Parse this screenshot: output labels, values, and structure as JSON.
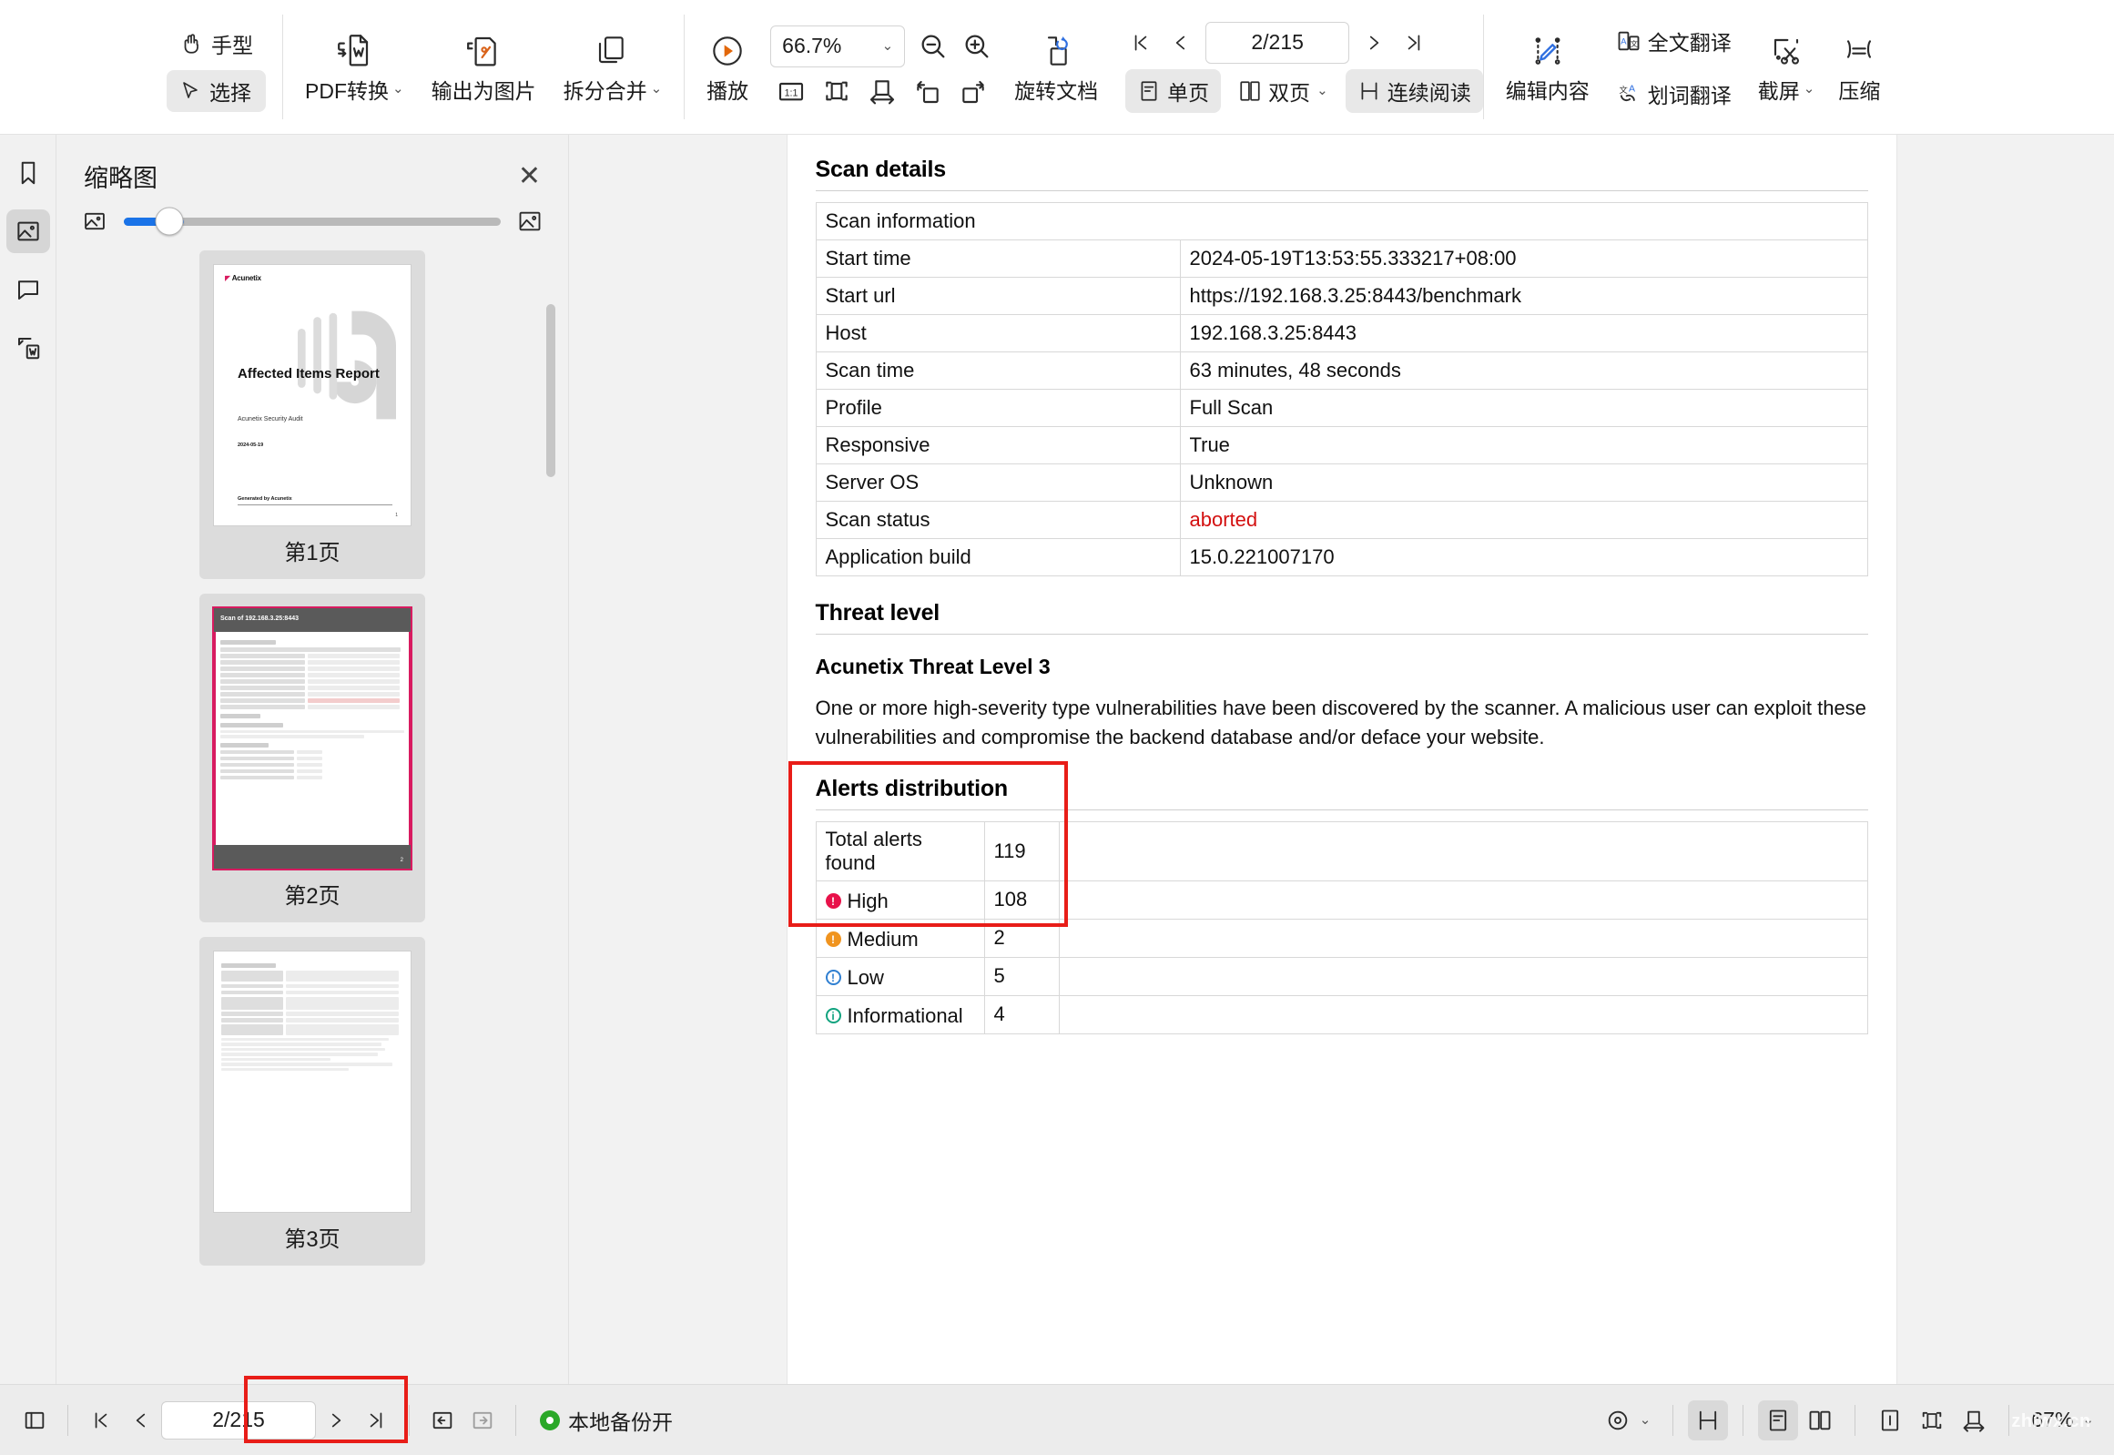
{
  "toolbar": {
    "hand_label": "手型",
    "select_label": "选择",
    "pdf_convert_label": "PDF转换",
    "export_image_label": "输出为图片",
    "split_merge_label": "拆分合并",
    "play_label": "播放",
    "zoom_value": "66.7%",
    "page_indicator": "2/215",
    "rotate_doc_label": "旋转文档",
    "single_page_label": "单页",
    "double_page_label": "双页",
    "continuous_read_label": "连续阅读",
    "edit_content_label": "编辑内容",
    "full_translate_label": "全文翻译",
    "word_translate_label": "划词翻译",
    "screenshot_label": "截屏",
    "compress_label": "压缩",
    "caret": "⌄"
  },
  "sidebar": {
    "rail_items": [
      {
        "name": "bookmark",
        "active": false
      },
      {
        "name": "thumbnail",
        "active": true
      },
      {
        "name": "comment",
        "active": false
      },
      {
        "name": "convert-word",
        "active": false
      }
    ],
    "panel_title": "缩略图",
    "close_label": "✕",
    "thumbnails": [
      {
        "label": "第1页",
        "selected": false
      },
      {
        "label": "第2页",
        "selected": true
      },
      {
        "label": "第3页",
        "selected": false
      }
    ],
    "thumb1": {
      "brand": "Acunetix",
      "title": "Affected Items Report",
      "subtitle": "Acunetix Security Audit",
      "date": "2024-05-19",
      "footer": "Generated by Acunetix",
      "page_no": "1"
    },
    "thumb2": {
      "header": "Scan of 192.168.3.25:8443",
      "page_no": "2"
    },
    "thumb3": {
      "header": "Affected Items"
    }
  },
  "document": {
    "scan_details": {
      "heading": "Scan details",
      "info_header": "Scan information",
      "rows": [
        {
          "key": "Start time",
          "value": "2024-05-19T13:53:55.333217+08:00",
          "red": false
        },
        {
          "key": "Start url",
          "value": "https://192.168.3.25:8443/benchmark",
          "red": false
        },
        {
          "key": "Host",
          "value": "192.168.3.25:8443",
          "red": false
        },
        {
          "key": "Scan time",
          "value": "63 minutes, 48 seconds",
          "red": false
        },
        {
          "key": "Profile",
          "value": "Full Scan",
          "red": false
        },
        {
          "key": "Responsive",
          "value": "True",
          "red": false
        },
        {
          "key": "Server OS",
          "value": "Unknown",
          "red": false
        },
        {
          "key": "Scan status",
          "value": "aborted",
          "red": true
        },
        {
          "key": "Application build",
          "value": "15.0.221007170",
          "red": false
        }
      ]
    },
    "threat_level": {
      "heading": "Threat level",
      "level_title": "Acunetix Threat Level 3",
      "paragraph": "One or more high-severity type vulnerabilities have been discovered by the scanner. A malicious user can exploit these vulnerabilities and compromise the backend database and/or deface your website."
    },
    "alerts_distribution": {
      "heading": "Alerts distribution",
      "rows": [
        {
          "label": "Total alerts found",
          "value": "119",
          "icon": "none",
          "color": ""
        },
        {
          "label": "High",
          "value": "108",
          "icon": "filled",
          "color": "#e8124a"
        },
        {
          "label": "Medium",
          "value": "2",
          "icon": "filled",
          "color": "#f0941f"
        },
        {
          "label": "Low",
          "value": "5",
          "icon": "ring",
          "color": "#2f7fd1"
        },
        {
          "label": "Informational",
          "value": "4",
          "icon": "ring",
          "color": "#12a37f"
        }
      ]
    }
  },
  "statusbar": {
    "page_indicator": "2/215",
    "backup_label": "本地备份开",
    "zoom_value": "67%",
    "watermark": "zhiwx.cn",
    "caret": "⌄"
  },
  "colors": {
    "accent_blue": "#1a73e8",
    "annotation_red": "#e81d18",
    "selected_thumb": "#d81b60",
    "status_red": "#d31010",
    "backup_green": "#2aa828"
  }
}
